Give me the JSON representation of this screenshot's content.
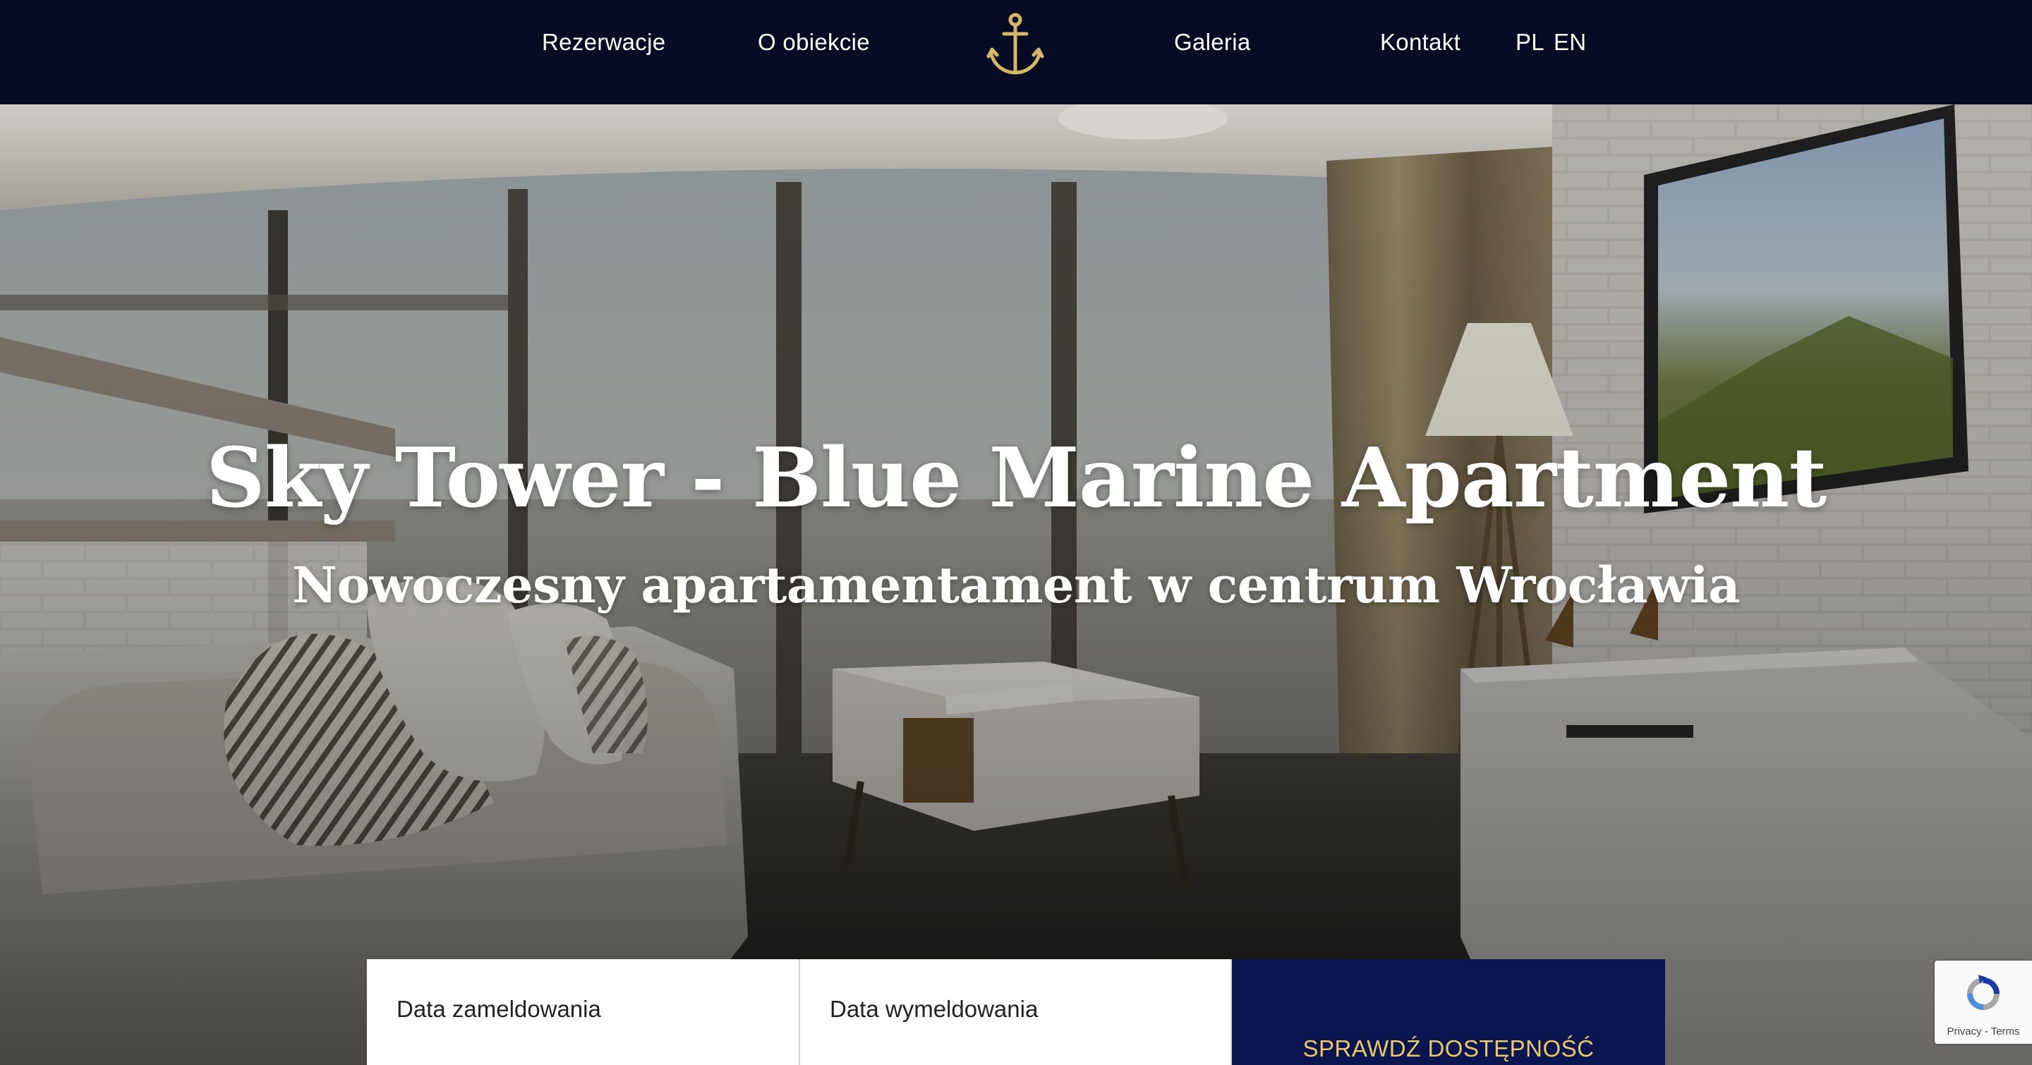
{
  "nav": {
    "items": [
      {
        "label": "Rezerwacje"
      },
      {
        "label": "O obiekcie"
      },
      {
        "label": "Galeria"
      },
      {
        "label": "Kontakt"
      }
    ],
    "languages": [
      "PL",
      "EN"
    ],
    "logo_icon": "anchor-icon",
    "background_color": "#070b24",
    "logo_color": "#d6b768"
  },
  "hero": {
    "title": "Sky Tower - Blue Marine Apartment",
    "subtitle": "Nowoczesny apartamentament w centrum Wrocławia"
  },
  "booking": {
    "checkin_placeholder": "Data zameldowania",
    "checkout_placeholder": "Data wymeldowania",
    "check_button": "SPRAWDŹ DOSTĘPNOŚĆ",
    "button_color": "#0b1650",
    "button_text_color": "#e9c86a"
  },
  "recaptcha": {
    "privacy": "Privacy",
    "separator": " - ",
    "terms": "Terms"
  }
}
